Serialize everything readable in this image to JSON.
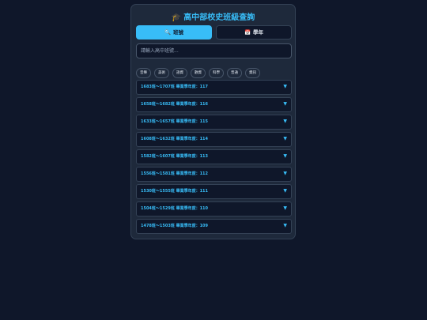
{
  "header": {
    "title": "高中部校史班級查詢",
    "icon": "graduation-cap-icon"
  },
  "tabs": [
    {
      "label": "班號",
      "icon": "search-icon",
      "active": true
    },
    {
      "label": "學年",
      "icon": "calendar-icon",
      "active": false
    }
  ],
  "search": {
    "placeholder": "請輸入高中班號...",
    "value": ""
  },
  "filters": [
    "音樂",
    "美術",
    "語資",
    "數資",
    "科學",
    "普通",
    "資訊"
  ],
  "accordion": [
    {
      "label": "1683班～1707班 畢業學年度：117"
    },
    {
      "label": "1658班～1682班 畢業學年度：116"
    },
    {
      "label": "1633班～1657班 畢業學年度：115"
    },
    {
      "label": "1608班～1632班 畢業學年度：114"
    },
    {
      "label": "1582班～1607班 畢業學年度：113"
    },
    {
      "label": "1556班～1581班 畢業學年度：112"
    },
    {
      "label": "1530班～1555班 畢業學年度：111"
    },
    {
      "label": "1504班～1529班 畢業學年度：110"
    },
    {
      "label": "1478班～1503班 畢業學年度：109"
    }
  ],
  "colors": {
    "background": "#0f172a",
    "card": "#1e293b",
    "accent": "#38bdf8",
    "text": "#e2e8f0"
  }
}
